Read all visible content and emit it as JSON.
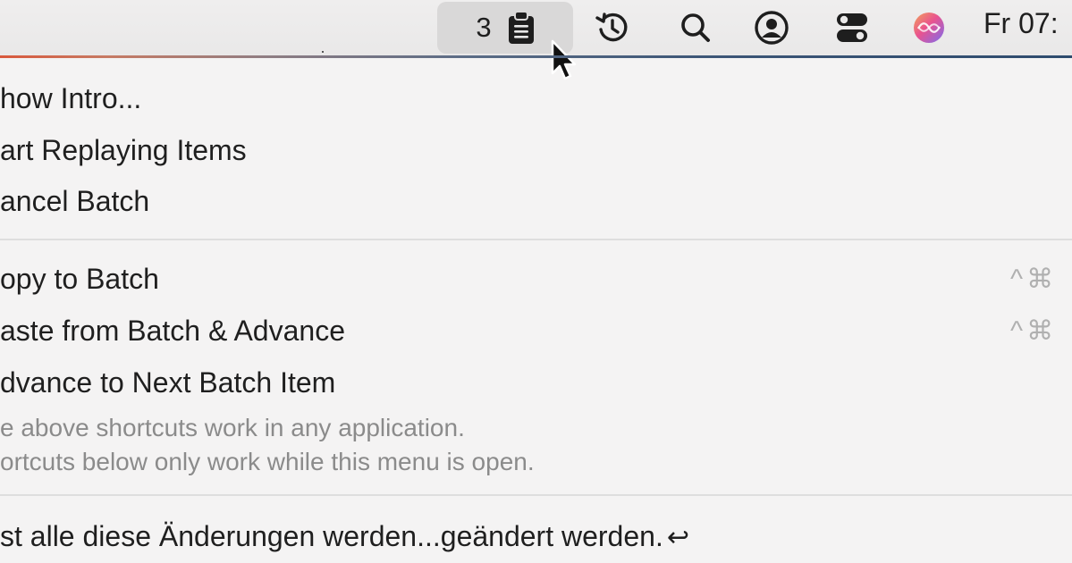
{
  "menubar": {
    "batch_count": "3",
    "clock": "Fr 07:",
    "icons": [
      "clipboard-icon",
      "history-icon",
      "search-icon",
      "user-icon",
      "control-center-icon",
      "siri-icon"
    ]
  },
  "menu": {
    "items_top": [
      {
        "label": "how Intro..."
      },
      {
        "label": "art Replaying Items"
      },
      {
        "label": "ancel Batch"
      }
    ],
    "items_mid": [
      {
        "label": "opy to Batch",
        "shortcut": "^⌘"
      },
      {
        "label": "aste from Batch & Advance",
        "shortcut": "^⌘"
      },
      {
        "label": "dvance to Next Batch Item"
      }
    ],
    "notes": [
      "e above shortcuts work in any application.",
      "ortcuts below only work while this menu is open."
    ],
    "items_bottom": [
      {
        "label": "st alle diese Änderungen werden...geändert werden.",
        "suffix": "↩"
      }
    ]
  },
  "colors": {
    "menu_bg": "#f4f3f3",
    "menubar_bg": "#eceaea",
    "highlight": "#d9d8d8",
    "edge_accent": "#d9583c",
    "edge_dark": "#2e4b6d"
  }
}
